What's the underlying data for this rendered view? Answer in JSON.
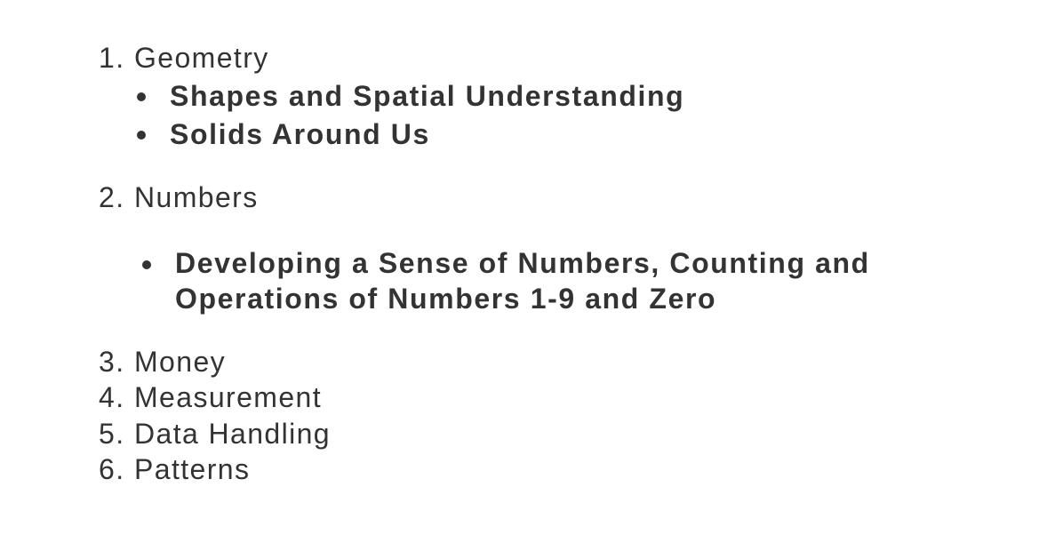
{
  "topics": [
    {
      "number": "1.",
      "title": "Geometry",
      "subtopics": [
        "Shapes and Spatial Understanding",
        "Solids Around Us"
      ]
    },
    {
      "number": "2.",
      "title": "Numbers",
      "subtopics": [
        "Developing a Sense of Numbers, Counting and",
        "Operations of Numbers 1-9 and Zero"
      ]
    },
    {
      "number": "3.",
      "title": "Money"
    },
    {
      "number": "4.",
      "title": "Measurement"
    },
    {
      "number": "5.",
      "title": "Data Handling"
    },
    {
      "number": "6.",
      "title": "Patterns"
    }
  ]
}
